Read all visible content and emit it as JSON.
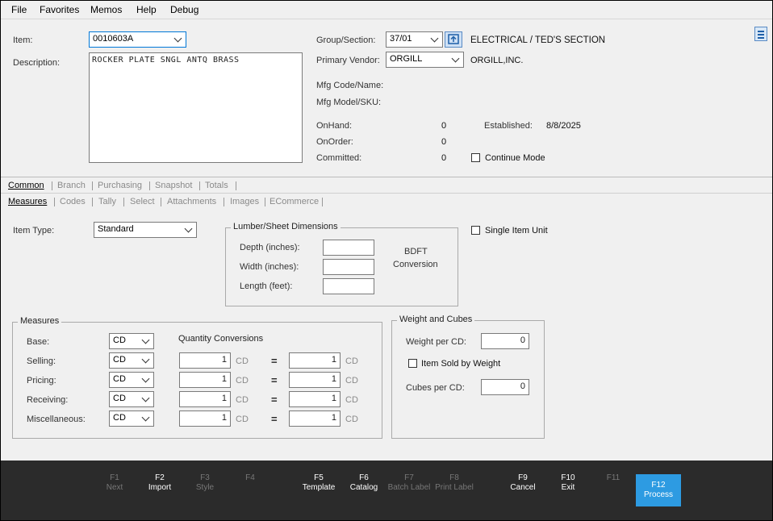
{
  "menu": [
    "File",
    "Favorites",
    "Memos",
    "Help",
    "Debug"
  ],
  "item": {
    "label": "Item:",
    "value": "0010603A",
    "desc_label": "Description:",
    "description": "ROCKER PLATE SNGL ANTQ BRASS"
  },
  "group_section": {
    "label": "Group/Section:",
    "value": "37/01",
    "name": "ELECTRICAL / TED'S SECTION"
  },
  "vendor": {
    "label": "Primary Vendor:",
    "value": "ORGILL",
    "name": "ORGILL,INC."
  },
  "mfg": {
    "code_label": "Mfg Code/Name:",
    "model_label": "Mfg Model/SKU:"
  },
  "stock": {
    "onhand_label": "OnHand:",
    "onhand": "0",
    "onorder_label": "OnOrder:",
    "onorder": "0",
    "committed_label": "Committed:",
    "committed": "0",
    "established_label": "Established:",
    "established": "8/8/2025",
    "continue_mode": "Continue Mode"
  },
  "tabs_top": [
    "Common",
    "Branch",
    "Purchasing",
    "Snapshot",
    "Totals"
  ],
  "tabs_sub": [
    "Measures",
    "Codes",
    "Tally",
    "Select",
    "Attachments",
    "Images",
    "ECommerce"
  ],
  "item_type": {
    "label": "Item Type:",
    "value": "Standard"
  },
  "lumber": {
    "title": "Lumber/Sheet Dimensions",
    "depth": "Depth (inches):",
    "width": "Width (inches):",
    "length": "Length (feet):",
    "bdft": "BDFT",
    "conversion": "Conversion"
  },
  "single_item_unit": "Single Item Unit",
  "measures": {
    "title": "Measures",
    "qty_conv": "Quantity Conversions",
    "base_label": "Base:",
    "base_unit": "CD",
    "rows": [
      {
        "label": "Selling:",
        "unit": "CD",
        "qty": "1",
        "unit2": "CD",
        "qty2": "1",
        "unit3": "CD",
        "eq": "="
      },
      {
        "label": "Pricing:",
        "unit": "CD",
        "qty": "1",
        "unit2": "CD",
        "qty2": "1",
        "unit3": "CD",
        "eq": "="
      },
      {
        "label": "Receiving:",
        "unit": "CD",
        "qty": "1",
        "unit2": "CD",
        "qty2": "1",
        "unit3": "CD",
        "eq": "="
      },
      {
        "label": "Miscellaneous:",
        "unit": "CD",
        "qty": "1",
        "unit2": "CD",
        "qty2": "1",
        "unit3": "CD",
        "eq": "="
      }
    ]
  },
  "weight": {
    "title": "Weight and Cubes",
    "weight_label": "Weight per CD:",
    "weight_value": "0",
    "sold_by_weight": "Item Sold by Weight",
    "cubes_label": "Cubes per CD:",
    "cubes_value": "0"
  },
  "fkeys": [
    {
      "key": "F1",
      "label": "Next",
      "state": "disabled"
    },
    {
      "key": "F2",
      "label": "Import",
      "state": "enabled"
    },
    {
      "key": "F3",
      "label": "Style",
      "state": "disabled"
    },
    {
      "key": "F4",
      "label": "",
      "state": "disabled"
    },
    {
      "key": "F5",
      "label": "Template",
      "state": "enabled"
    },
    {
      "key": "F6",
      "label": "Catalog",
      "state": "enabled"
    },
    {
      "key": "F7",
      "label": "Batch Label",
      "state": "disabled"
    },
    {
      "key": "F8",
      "label": "Print Label",
      "state": "disabled"
    },
    {
      "key": "F9",
      "label": "Cancel",
      "state": "enabled"
    },
    {
      "key": "F10",
      "label": "Exit",
      "state": "enabled"
    },
    {
      "key": "F11",
      "label": "",
      "state": "disabled"
    },
    {
      "key": "F12",
      "label": "Process",
      "state": "primary"
    }
  ],
  "colors": {
    "accent": "#2d9be2",
    "footer": "#2b2b2b",
    "window": "#f0f0f0"
  }
}
